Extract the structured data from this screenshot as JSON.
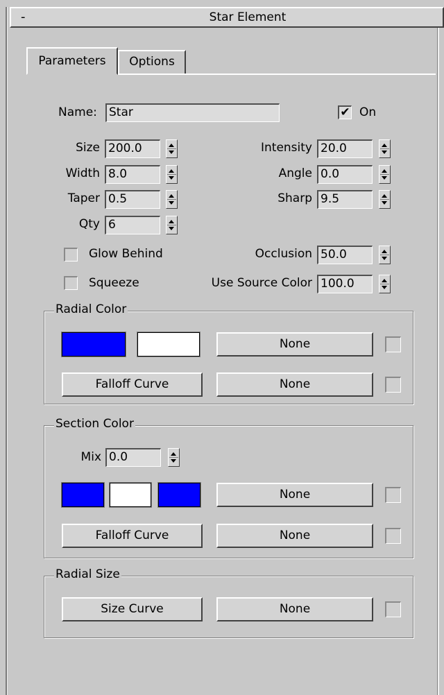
{
  "rollout": {
    "collapse_symbol": "-",
    "title": "Star Element"
  },
  "tabs": [
    {
      "label": "Parameters",
      "active": true
    },
    {
      "label": "Options",
      "active": false
    }
  ],
  "name": {
    "label": "Name:",
    "value": "Star"
  },
  "on": {
    "label": "On",
    "checked": true,
    "check_glyph": "✔"
  },
  "params_left": [
    {
      "label": "Size",
      "value": "200.0"
    },
    {
      "label": "Width",
      "value": "8.0"
    },
    {
      "label": "Taper",
      "value": "0.5"
    },
    {
      "label": "Qty",
      "value": "6"
    }
  ],
  "params_right": [
    {
      "label": "Intensity",
      "value": "20.0"
    },
    {
      "label": "Angle",
      "value": "0.0"
    },
    {
      "label": "Sharp",
      "value": "9.5"
    }
  ],
  "glow_behind": {
    "label": "Glow Behind",
    "checked": false
  },
  "squeeze": {
    "label": "Squeeze",
    "checked": false
  },
  "occlusion": {
    "label": "Occlusion",
    "value": "50.0"
  },
  "use_source_color": {
    "label": "Use Source Color",
    "value": "100.0"
  },
  "radial_color": {
    "title": "Radial Color",
    "swatches": [
      "#0000ff",
      "#ffffff"
    ],
    "map_button": "None",
    "falloff_button": "Falloff Curve",
    "falloff_map_button": "None"
  },
  "section_color": {
    "title": "Section Color",
    "mix": {
      "label": "Mix",
      "value": "0.0"
    },
    "swatches": [
      "#0000ff",
      "#ffffff",
      "#0000ff"
    ],
    "map_button": "None",
    "falloff_button": "Falloff Curve",
    "falloff_map_button": "None"
  },
  "radial_size": {
    "title": "Radial Size",
    "size_curve_button": "Size Curve",
    "map_button": "None"
  }
}
